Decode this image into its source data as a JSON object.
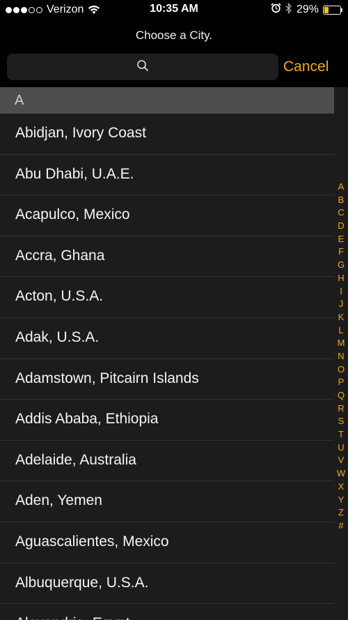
{
  "status_bar": {
    "carrier": "Verizon",
    "signal_dots_filled": 3,
    "signal_dots_total": 5,
    "time": "10:35 AM",
    "battery_percent": "29%",
    "battery_level": 0.29,
    "battery_color": "#f5c400"
  },
  "header": {
    "title": "Choose a City.",
    "search_placeholder": "",
    "search_icon": "magnifying-glass",
    "cancel_label": "Cancel",
    "accent_color": "#f5a623"
  },
  "section": {
    "header": "A"
  },
  "cities": [
    "Abidjan, Ivory Coast",
    "Abu Dhabi, U.A.E.",
    "Acapulco, Mexico",
    "Accra, Ghana",
    "Acton, U.S.A.",
    "Adak, U.S.A.",
    "Adamstown, Pitcairn Islands",
    "Addis Ababa, Ethiopia",
    "Adelaide, Australia",
    "Aden, Yemen",
    "Aguascalientes, Mexico",
    "Albuquerque, U.S.A.",
    "Alexandria, Egypt"
  ],
  "index_letters": [
    "A",
    "B",
    "C",
    "D",
    "E",
    "F",
    "G",
    "H",
    "I",
    "J",
    "K",
    "L",
    "M",
    "N",
    "O",
    "P",
    "Q",
    "R",
    "S",
    "T",
    "U",
    "V",
    "W",
    "X",
    "Y",
    "Z",
    "#"
  ]
}
